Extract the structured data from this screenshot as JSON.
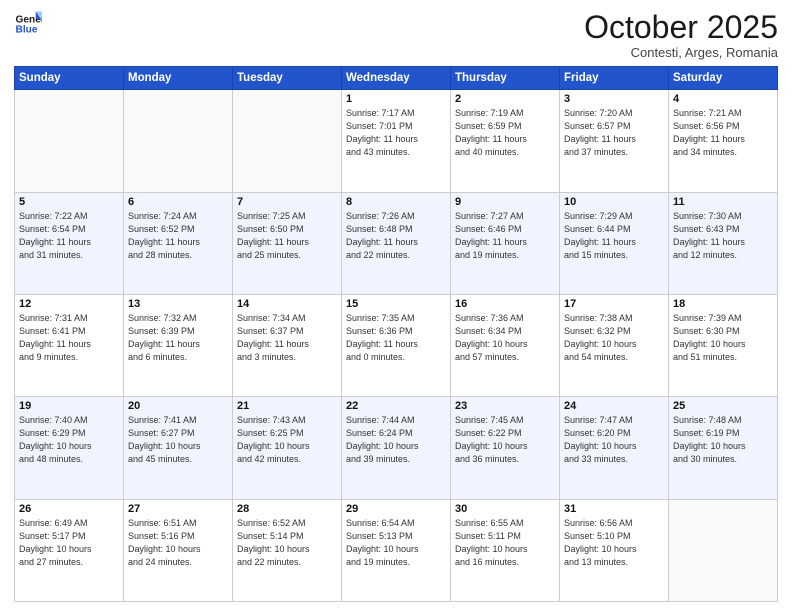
{
  "header": {
    "logo_line1": "General",
    "logo_line2": "Blue",
    "month": "October 2025",
    "location": "Contesti, Arges, Romania"
  },
  "weekdays": [
    "Sunday",
    "Monday",
    "Tuesday",
    "Wednesday",
    "Thursday",
    "Friday",
    "Saturday"
  ],
  "weeks": [
    [
      {
        "day": "",
        "info": ""
      },
      {
        "day": "",
        "info": ""
      },
      {
        "day": "",
        "info": ""
      },
      {
        "day": "1",
        "info": "Sunrise: 7:17 AM\nSunset: 7:01 PM\nDaylight: 11 hours\nand 43 minutes."
      },
      {
        "day": "2",
        "info": "Sunrise: 7:19 AM\nSunset: 6:59 PM\nDaylight: 11 hours\nand 40 minutes."
      },
      {
        "day": "3",
        "info": "Sunrise: 7:20 AM\nSunset: 6:57 PM\nDaylight: 11 hours\nand 37 minutes."
      },
      {
        "day": "4",
        "info": "Sunrise: 7:21 AM\nSunset: 6:56 PM\nDaylight: 11 hours\nand 34 minutes."
      }
    ],
    [
      {
        "day": "5",
        "info": "Sunrise: 7:22 AM\nSunset: 6:54 PM\nDaylight: 11 hours\nand 31 minutes."
      },
      {
        "day": "6",
        "info": "Sunrise: 7:24 AM\nSunset: 6:52 PM\nDaylight: 11 hours\nand 28 minutes."
      },
      {
        "day": "7",
        "info": "Sunrise: 7:25 AM\nSunset: 6:50 PM\nDaylight: 11 hours\nand 25 minutes."
      },
      {
        "day": "8",
        "info": "Sunrise: 7:26 AM\nSunset: 6:48 PM\nDaylight: 11 hours\nand 22 minutes."
      },
      {
        "day": "9",
        "info": "Sunrise: 7:27 AM\nSunset: 6:46 PM\nDaylight: 11 hours\nand 19 minutes."
      },
      {
        "day": "10",
        "info": "Sunrise: 7:29 AM\nSunset: 6:44 PM\nDaylight: 11 hours\nand 15 minutes."
      },
      {
        "day": "11",
        "info": "Sunrise: 7:30 AM\nSunset: 6:43 PM\nDaylight: 11 hours\nand 12 minutes."
      }
    ],
    [
      {
        "day": "12",
        "info": "Sunrise: 7:31 AM\nSunset: 6:41 PM\nDaylight: 11 hours\nand 9 minutes."
      },
      {
        "day": "13",
        "info": "Sunrise: 7:32 AM\nSunset: 6:39 PM\nDaylight: 11 hours\nand 6 minutes."
      },
      {
        "day": "14",
        "info": "Sunrise: 7:34 AM\nSunset: 6:37 PM\nDaylight: 11 hours\nand 3 minutes."
      },
      {
        "day": "15",
        "info": "Sunrise: 7:35 AM\nSunset: 6:36 PM\nDaylight: 11 hours\nand 0 minutes."
      },
      {
        "day": "16",
        "info": "Sunrise: 7:36 AM\nSunset: 6:34 PM\nDaylight: 10 hours\nand 57 minutes."
      },
      {
        "day": "17",
        "info": "Sunrise: 7:38 AM\nSunset: 6:32 PM\nDaylight: 10 hours\nand 54 minutes."
      },
      {
        "day": "18",
        "info": "Sunrise: 7:39 AM\nSunset: 6:30 PM\nDaylight: 10 hours\nand 51 minutes."
      }
    ],
    [
      {
        "day": "19",
        "info": "Sunrise: 7:40 AM\nSunset: 6:29 PM\nDaylight: 10 hours\nand 48 minutes."
      },
      {
        "day": "20",
        "info": "Sunrise: 7:41 AM\nSunset: 6:27 PM\nDaylight: 10 hours\nand 45 minutes."
      },
      {
        "day": "21",
        "info": "Sunrise: 7:43 AM\nSunset: 6:25 PM\nDaylight: 10 hours\nand 42 minutes."
      },
      {
        "day": "22",
        "info": "Sunrise: 7:44 AM\nSunset: 6:24 PM\nDaylight: 10 hours\nand 39 minutes."
      },
      {
        "day": "23",
        "info": "Sunrise: 7:45 AM\nSunset: 6:22 PM\nDaylight: 10 hours\nand 36 minutes."
      },
      {
        "day": "24",
        "info": "Sunrise: 7:47 AM\nSunset: 6:20 PM\nDaylight: 10 hours\nand 33 minutes."
      },
      {
        "day": "25",
        "info": "Sunrise: 7:48 AM\nSunset: 6:19 PM\nDaylight: 10 hours\nand 30 minutes."
      }
    ],
    [
      {
        "day": "26",
        "info": "Sunrise: 6:49 AM\nSunset: 5:17 PM\nDaylight: 10 hours\nand 27 minutes."
      },
      {
        "day": "27",
        "info": "Sunrise: 6:51 AM\nSunset: 5:16 PM\nDaylight: 10 hours\nand 24 minutes."
      },
      {
        "day": "28",
        "info": "Sunrise: 6:52 AM\nSunset: 5:14 PM\nDaylight: 10 hours\nand 22 minutes."
      },
      {
        "day": "29",
        "info": "Sunrise: 6:54 AM\nSunset: 5:13 PM\nDaylight: 10 hours\nand 19 minutes."
      },
      {
        "day": "30",
        "info": "Sunrise: 6:55 AM\nSunset: 5:11 PM\nDaylight: 10 hours\nand 16 minutes."
      },
      {
        "day": "31",
        "info": "Sunrise: 6:56 AM\nSunset: 5:10 PM\nDaylight: 10 hours\nand 13 minutes."
      },
      {
        "day": "",
        "info": ""
      }
    ]
  ]
}
